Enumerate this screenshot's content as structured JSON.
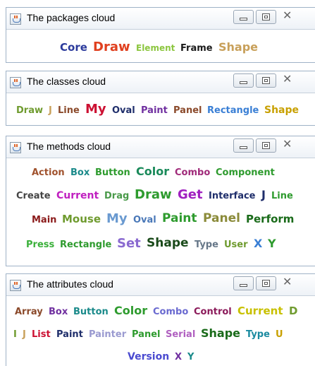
{
  "colors": {
    "navy": "#2b3a9c",
    "red": "#e0401f",
    "olive": "#6f9b2f",
    "black": "#1a1a1a",
    "tan": "#c8a05a",
    "green": "#2e9b2e",
    "lime": "#8cc63f",
    "brown": "#8b4a2b",
    "crimson": "#cc1133",
    "darkred": "#8b1a1a",
    "navyblue": "#1f2e6b",
    "purple": "#7030a0",
    "teal": "#1a8a8a",
    "sky": "#3a7fd5",
    "gold": "#c8a000",
    "magenta": "#c020c0",
    "orange": "#d87a1a",
    "darkgreen": "#1a6b1a",
    "slate": "#667788",
    "lavender": "#9a9ad0",
    "pink": "#e0308a"
  },
  "windows": [
    {
      "title": "The packages cloud",
      "icon": "java-cup-icon",
      "controls": [
        "minimize-icon",
        "maximize-icon",
        "close-icon"
      ],
      "words": [
        {
          "text": "Core",
          "size": 15,
          "color": "#2b3a9c"
        },
        {
          "text": "Draw",
          "size": 18,
          "color": "#e0401f"
        },
        {
          "text": "Element",
          "size": 12,
          "color": "#8cc63f"
        },
        {
          "text": "Frame",
          "size": 13,
          "color": "#1a1a1a"
        },
        {
          "text": "Shape",
          "size": 16,
          "color": "#c8a05a"
        }
      ]
    },
    {
      "title": "The classes cloud",
      "icon": "java-cup-icon",
      "controls": [
        "minimize-icon",
        "maximize-icon",
        "close-icon"
      ],
      "words": [
        {
          "text": "Draw",
          "size": 13,
          "color": "#6f9b2f"
        },
        {
          "text": "J",
          "size": 13,
          "color": "#c8a05a"
        },
        {
          "text": "Line",
          "size": 13,
          "color": "#8b4a2b"
        },
        {
          "text": "My",
          "size": 18,
          "color": "#cc1133"
        },
        {
          "text": "Oval",
          "size": 13,
          "color": "#1f2e6b"
        },
        {
          "text": "Paint",
          "size": 13,
          "color": "#7030a0"
        },
        {
          "text": "Panel",
          "size": 13,
          "color": "#8b4a2b"
        },
        {
          "text": "Rectangle",
          "size": 13,
          "color": "#3a7fd5"
        },
        {
          "text": "Shape",
          "size": 14,
          "color": "#c8a000"
        }
      ]
    },
    {
      "title": "The methods cloud",
      "icon": "java-cup-icon",
      "controls": [
        "minimize-icon",
        "maximize-icon",
        "close-icon"
      ],
      "words": [
        {
          "text": "Action",
          "size": 13,
          "color": "#a0522d"
        },
        {
          "text": "Box",
          "size": 13,
          "color": "#1a8a8a"
        },
        {
          "text": "Button",
          "size": 13,
          "color": "#2e9b2e"
        },
        {
          "text": "Color",
          "size": 16,
          "color": "#1a8a5a"
        },
        {
          "text": "Combo",
          "size": 13,
          "color": "#a02a7a"
        },
        {
          "text": "Component",
          "size": 13,
          "color": "#2e9b2e"
        },
        {
          "text": "Create",
          "size": 13,
          "color": "#444444"
        },
        {
          "text": "Current",
          "size": 14,
          "color": "#c020c0"
        },
        {
          "text": "Drag",
          "size": 13,
          "color": "#4a9a4a"
        },
        {
          "text": "Draw",
          "size": 18,
          "color": "#2e9b2e"
        },
        {
          "text": "Get",
          "size": 18,
          "color": "#a020c0"
        },
        {
          "text": "Interface",
          "size": 13,
          "color": "#1f2e6b"
        },
        {
          "text": "J",
          "size": 16,
          "color": "#1f2e6b"
        },
        {
          "text": "Line",
          "size": 13,
          "color": "#2e9b2e"
        },
        {
          "text": "Main",
          "size": 13,
          "color": "#8b1a1a"
        },
        {
          "text": "Mouse",
          "size": 15,
          "color": "#6f9b2f"
        },
        {
          "text": "My",
          "size": 18,
          "color": "#6a9ad0"
        },
        {
          "text": "Oval",
          "size": 13,
          "color": "#4a78b8"
        },
        {
          "text": "Paint",
          "size": 17,
          "color": "#2e9b2e"
        },
        {
          "text": "Panel",
          "size": 17,
          "color": "#8b8b3a"
        },
        {
          "text": "Perform",
          "size": 15,
          "color": "#1a6b1a"
        },
        {
          "text": "Press",
          "size": 13,
          "color": "#3ab03a"
        },
        {
          "text": "Rectangle",
          "size": 13,
          "color": "#2e9b2e"
        },
        {
          "text": "Set",
          "size": 18,
          "color": "#8a6ad0"
        },
        {
          "text": "Shape",
          "size": 17,
          "color": "#1a4a1a"
        },
        {
          "text": "Type",
          "size": 13,
          "color": "#667788"
        },
        {
          "text": "User",
          "size": 13,
          "color": "#6f9b2f"
        },
        {
          "text": "X",
          "size": 16,
          "color": "#3a7fd5"
        },
        {
          "text": "Y",
          "size": 16,
          "color": "#2e9b2e"
        }
      ]
    },
    {
      "title": "The attributes cloud",
      "icon": "java-cup-icon",
      "controls": [
        "minimize-icon",
        "maximize-icon",
        "close-icon"
      ],
      "words": [
        {
          "text": "Array",
          "size": 13,
          "color": "#8b4a2b"
        },
        {
          "text": "Box",
          "size": 13,
          "color": "#7030a0"
        },
        {
          "text": "Button",
          "size": 13,
          "color": "#1a8a8a"
        },
        {
          "text": "Color",
          "size": 16,
          "color": "#2e9b2e"
        },
        {
          "text": "Combo",
          "size": 13,
          "color": "#6a6ad0"
        },
        {
          "text": "Control",
          "size": 13,
          "color": "#8b1a5a"
        },
        {
          "text": "Current",
          "size": 15,
          "color": "#c8c000"
        },
        {
          "text": "D",
          "size": 15,
          "color": "#6f9b2f"
        },
        {
          "text": "I",
          "size": 13,
          "color": "#6f9b2f"
        },
        {
          "text": "J",
          "size": 13,
          "color": "#c8a05a"
        },
        {
          "text": "List",
          "size": 13,
          "color": "#cc1133"
        },
        {
          "text": "Paint",
          "size": 13,
          "color": "#1f2e6b"
        },
        {
          "text": "Painter",
          "size": 13,
          "color": "#9a9ad0"
        },
        {
          "text": "Panel",
          "size": 13,
          "color": "#2e9b2e"
        },
        {
          "text": "Serial",
          "size": 13,
          "color": "#b060c0"
        },
        {
          "text": "Shape",
          "size": 16,
          "color": "#1a6b1a"
        },
        {
          "text": "Type",
          "size": 13,
          "color": "#1a8aa0"
        },
        {
          "text": "U",
          "size": 13,
          "color": "#c8a000"
        },
        {
          "text": "Version",
          "size": 14,
          "color": "#4a4ad0"
        },
        {
          "text": "X",
          "size": 13,
          "color": "#7030a0"
        },
        {
          "text": "Y",
          "size": 13,
          "color": "#1a8a8a"
        }
      ]
    }
  ]
}
